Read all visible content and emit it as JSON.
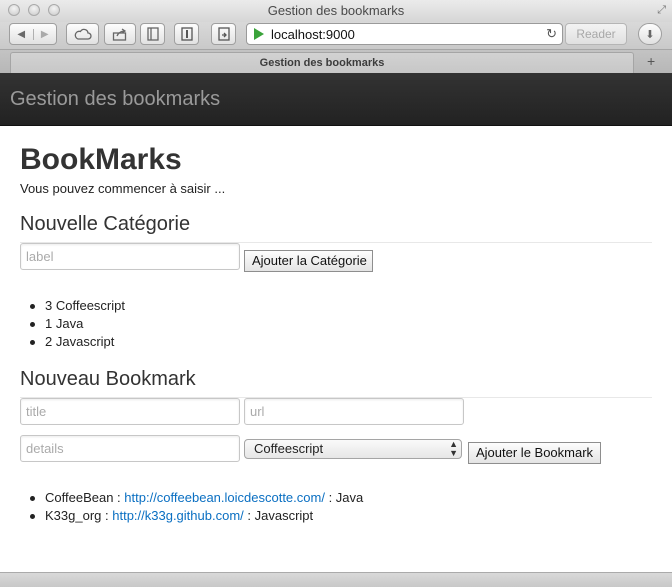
{
  "browser": {
    "window_title": "Gestion des bookmarks",
    "address": "localhost:9000",
    "reader_label": "Reader",
    "tab_title": "Gestion des bookmarks",
    "new_tab_label": "+"
  },
  "navbar": {
    "brand": "Gestion des bookmarks"
  },
  "page": {
    "title": "BookMarks",
    "subtitle": "Vous pouvez commencer à saisir ..."
  },
  "category_form": {
    "heading": "Nouvelle Catégorie",
    "label_placeholder": "label",
    "submit_label": "Ajouter la Catégorie"
  },
  "categories": [
    {
      "count": "3",
      "name": "Coffeescript"
    },
    {
      "count": "1",
      "name": "Java"
    },
    {
      "count": "2",
      "name": "Javascript"
    }
  ],
  "bookmark_form": {
    "heading": "Nouveau Bookmark",
    "title_placeholder": "title",
    "url_placeholder": "url",
    "details_placeholder": "details",
    "category_selected": "Coffeescript",
    "submit_label": "Ajouter le Bookmark"
  },
  "bookmarks": [
    {
      "title": "CoffeeBean",
      "url": "http://coffeebean.loicdescotte.com/",
      "category": "Java"
    },
    {
      "title": "K33g_org",
      "url": "http://k33g.github.com/",
      "category": "Javascript"
    }
  ],
  "icons": {
    "back": "◀",
    "forward": "▶",
    "reload": "↻",
    "downloads": "⬇"
  }
}
